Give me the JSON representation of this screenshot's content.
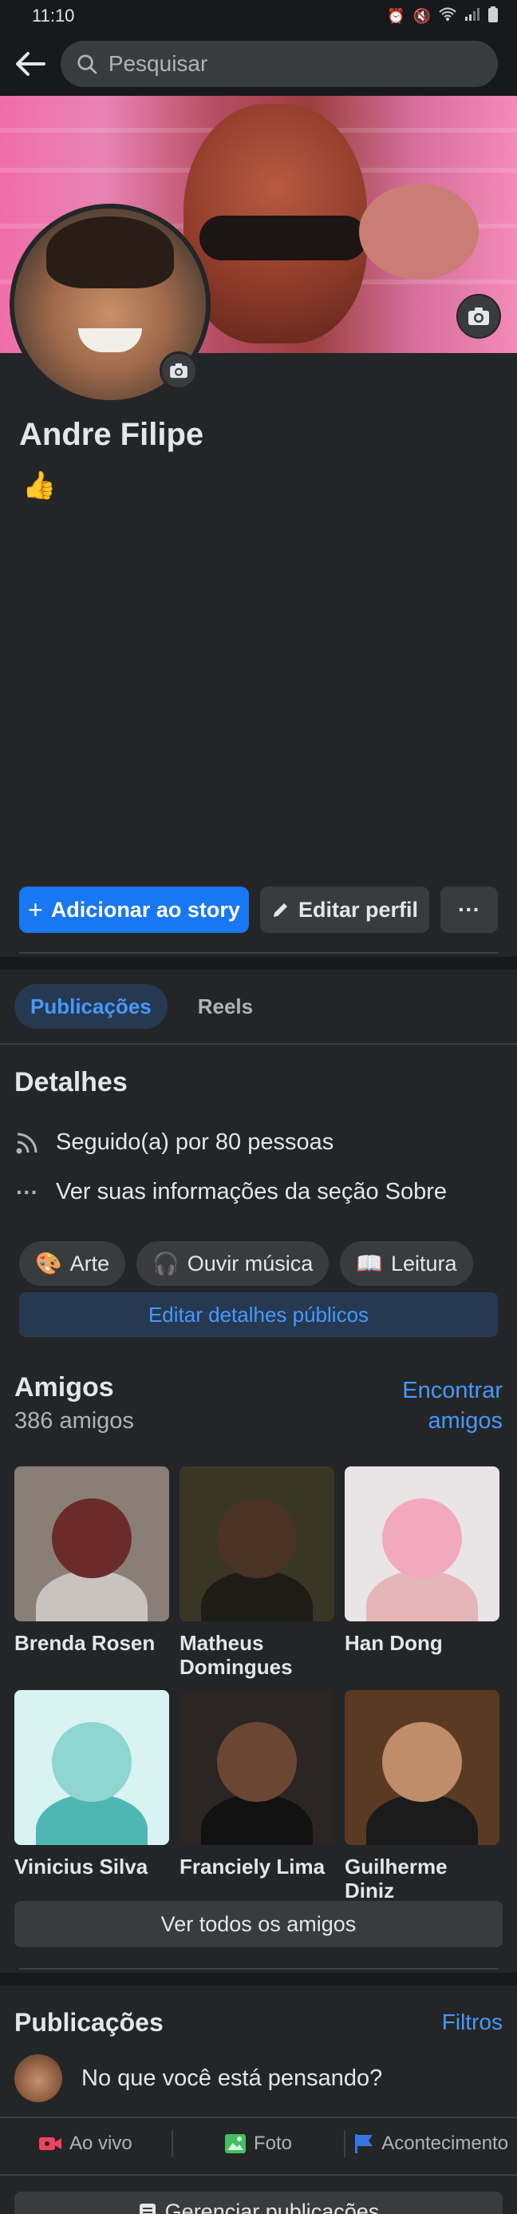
{
  "status_bar": {
    "time": "11:10",
    "icons": [
      "alarm-icon",
      "mute-icon",
      "wifi-icon",
      "signal-icon",
      "battery-icon"
    ]
  },
  "search": {
    "placeholder": "Pesquisar"
  },
  "profile": {
    "name": "Andre Filipe",
    "bio": "👍"
  },
  "actions": {
    "add_story": "Adicionar ao story",
    "edit_profile": "Editar perfil",
    "more": "···"
  },
  "tabs": [
    {
      "label": "Publicações",
      "active": true
    },
    {
      "label": "Reels",
      "active": false
    }
  ],
  "details": {
    "title": "Detalhes",
    "followers": "Seguido(a) por 80 pessoas",
    "about": "Ver suas informações da seção Sobre",
    "hobbies": [
      {
        "emoji": "🎨",
        "label": "Arte"
      },
      {
        "emoji": "🎧",
        "label": "Ouvir música"
      },
      {
        "emoji": "📖",
        "label": "Leitura"
      }
    ],
    "edit_public": "Editar detalhes públicos"
  },
  "friends": {
    "title": "Amigos",
    "count": "386 amigos",
    "find_line1": "Encontrar",
    "find_line2": "amigos",
    "list": [
      {
        "name": "Brenda Rosen",
        "bg": "#8a7f77",
        "fig": "#6b2b2a",
        "body": "#c9c3c0"
      },
      {
        "name": "Matheus Domingues",
        "bg": "#3a3626",
        "fig": "#4a3324",
        "body": "#1d1c17"
      },
      {
        "name": "Han Dong",
        "bg": "#e9e4e6",
        "fig": "#f3a9bd",
        "body": "#e6b5b8"
      },
      {
        "name": "Vinicius Silva",
        "bg": "#d9f2f2",
        "fig": "#8fd6d1",
        "body": "#4fb7b3"
      },
      {
        "name": "Franciely Lima",
        "bg": "#2b2624",
        "fig": "#6b4633",
        "body": "#121212"
      },
      {
        "name": "Guilherme Diniz",
        "bg": "#5a3a22",
        "fig": "#c08d6b",
        "body": "#1b1b1b"
      }
    ],
    "see_all": "Ver todos os amigos"
  },
  "posts": {
    "title": "Publicações",
    "filters": "Filtros",
    "composer": "No que você está pensando?",
    "actions": [
      {
        "label": "Ao vivo",
        "color": "#f3425f"
      },
      {
        "label": "Foto",
        "color": "#45bd62"
      },
      {
        "label": "Acontecimento",
        "color": "#3578e5"
      }
    ],
    "manage": "Gerenciar publicações"
  }
}
